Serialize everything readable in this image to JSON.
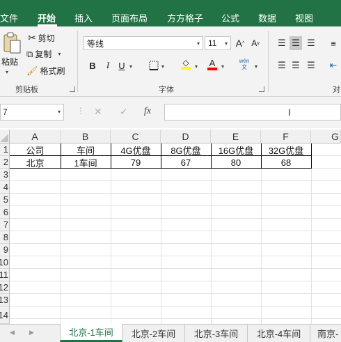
{
  "ribbon_tabs": [
    "文件",
    "开始",
    "插入",
    "页面布局",
    "方方格子",
    "公式",
    "数据",
    "视图"
  ],
  "clipboard": {
    "paste": "粘贴",
    "cut": "剪切",
    "copy": "复制",
    "format_painter": "格式刷",
    "group_label": "剪贴板"
  },
  "font": {
    "name": "等线",
    "size": "11",
    "grow": "A",
    "shrink": "A",
    "bold": "B",
    "italic": "I",
    "underline": "U",
    "font_color_glyph": "A",
    "phonetic": "wén\n文",
    "group_label": "字体"
  },
  "alignment": {
    "group_label_partial": "对"
  },
  "formula_bar": {
    "name_box": "7",
    "cancel": "✕",
    "enter": "✓",
    "fx": "fx",
    "value": ""
  },
  "columns": [
    "A",
    "B",
    "C",
    "D",
    "E",
    "F",
    "G"
  ],
  "row_numbers": [
    "1",
    "2",
    "3",
    "4",
    "5",
    "6",
    "7",
    "8",
    "9",
    "10",
    "11",
    "12",
    "13",
    "14"
  ],
  "table": {
    "headers": [
      "公司",
      "车间",
      "4G优盘",
      "8G优盘",
      "16G优盘",
      "32G优盘"
    ],
    "rows": [
      [
        "北京",
        "1车间",
        "79",
        "67",
        "80",
        "68"
      ]
    ]
  },
  "sheets": [
    "北京-1车间",
    "北京-2车间",
    "北京-3车间",
    "北京-4车间",
    "南京-"
  ],
  "active_sheet": "北京-1车间",
  "colors": {
    "brand_green": "#217346",
    "font_highlight": "#ffff00",
    "font_color": "#ff0000"
  }
}
